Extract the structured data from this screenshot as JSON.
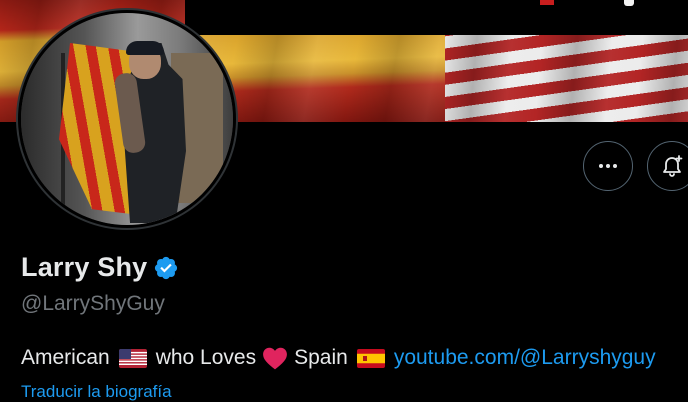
{
  "profile": {
    "display_name": "Larry Shy",
    "handle": "@LarryShyGuy",
    "verified_icon": "verified-badge-icon",
    "colors": {
      "verified": "#1d9bf0",
      "link": "#1d9bf0",
      "heart": "#e0245e",
      "border": "#536471"
    }
  },
  "bio": {
    "part1": "American",
    "flag1": "us-flag-icon",
    "part2": "who Loves",
    "heart": "red-heart-icon",
    "part3": "Spain",
    "flag2": "spain-flag-icon",
    "link": "youtube.com/@Larryshyguy"
  },
  "translate_label": "Traducir la biografía",
  "actions": {
    "more_icon": "more-dots-icon",
    "notify_icon": "bell-plus-icon"
  }
}
